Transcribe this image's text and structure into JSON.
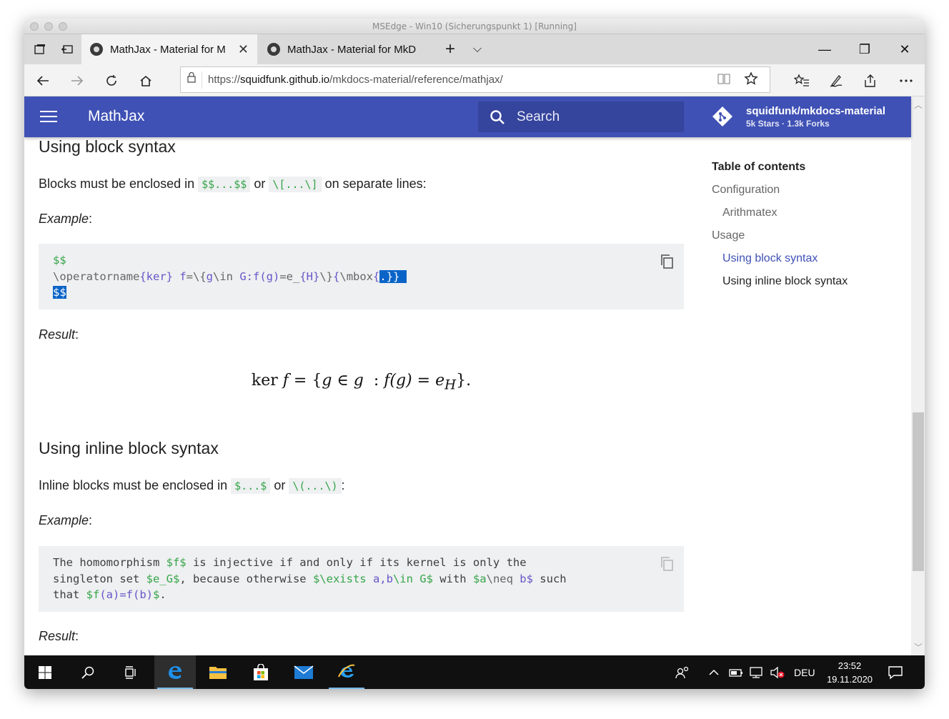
{
  "vm": {
    "title": "MSEdge - Win10 (Sicherungspunkt 1) [Running]"
  },
  "browser": {
    "tabs": [
      {
        "label": "MathJax - Material for M",
        "close": "✕"
      },
      {
        "label": "MathJax - Material for MkD"
      }
    ],
    "new_tab": "+",
    "tab_menu": "⌵",
    "window_controls": {
      "minimize": "—",
      "restore": "❐",
      "close": "✕"
    },
    "url_prefix": "https://",
    "url_host": "squidfunk.github.io",
    "url_path": "/mkdocs-material/reference/mathjax/"
  },
  "site": {
    "header_title": "MathJax",
    "search_placeholder": "Search",
    "repo_name": "squidfunk/mkdocs-material",
    "repo_facts": "5k Stars · 1.3k Forks",
    "colors": {
      "primary": "#3f51b5",
      "code_green": "#37a54a",
      "code_purple": "#6a55c8"
    }
  },
  "article": {
    "block": {
      "heading": "Using block syntax",
      "intro_before": "Blocks must be enclosed in ",
      "code1": "$$...$$",
      "intro_or": " or ",
      "code2": "\\[...\\]",
      "intro_after": " on separate lines:",
      "example_label": "Example",
      "example_colon": ":",
      "code_lines": {
        "l1": "$$",
        "l2_a": "\\operatorname",
        "l2_b": "{ker}",
        "l2_c": " f",
        "l2_d": "=\\{",
        "l2_e": "g",
        "l2_f": "\\in",
        "l2_g": " G:f(g)",
        "l2_h": "=e_",
        "l2_i": "{H}",
        "l2_j": "\\}",
        "l2_k": "{",
        "l2_l": "\\mbox",
        "l2_m": "{",
        "l2_sel": ".}}",
        "l3": "$$"
      },
      "result_label": "Result",
      "result_colon": ":",
      "math": {
        "op": "ker",
        "f": "f",
        "eq": " = {",
        "g": "g",
        "in": " ∈ ",
        "g2": "g",
        "colon": "  : ",
        "fg": "f(g)",
        "eq2": " = ",
        "e": "e",
        "sub": "H",
        "close": "}."
      }
    },
    "inline": {
      "heading": "Using inline block syntax",
      "intro_before": "Inline blocks must be enclosed in ",
      "code1": "$...$",
      "intro_or": " or ",
      "code2": "\\(...\\)",
      "intro_after": ":",
      "example_label": "Example",
      "example_colon": ":",
      "code_lines": {
        "l1_a": "The homomorphism ",
        "l1_b": "$f$",
        "l1_c": " is injective if and only if its kernel is only the",
        "l2_a": "singleton set ",
        "l2_b": "$e_G$",
        "l2_c": ", because otherwise ",
        "l2_d": "$\\exists ",
        "l2_e": "a,b",
        "l2_f": "\\in G$",
        "l2_g": " with ",
        "l2_h": "$a",
        "l2_i": "\\neq",
        "l2_j": " b$",
        "l2_k": " such",
        "l3_a": "that ",
        "l3_b": "$f",
        "l3_c": "(a)=f(b)",
        "l3_d": "$",
        "l3_e": "."
      },
      "result_label": "Result",
      "result_colon": ":"
    }
  },
  "toc": {
    "title": "Table of contents",
    "items": [
      {
        "label": "Configuration"
      },
      {
        "label": "Arithmatex"
      },
      {
        "label": "Usage"
      },
      {
        "label": "Using block syntax"
      },
      {
        "label": "Using inline block syntax"
      }
    ]
  },
  "taskbar": {
    "language": "DEU",
    "time": "23:52",
    "date": "19.11.2020"
  }
}
